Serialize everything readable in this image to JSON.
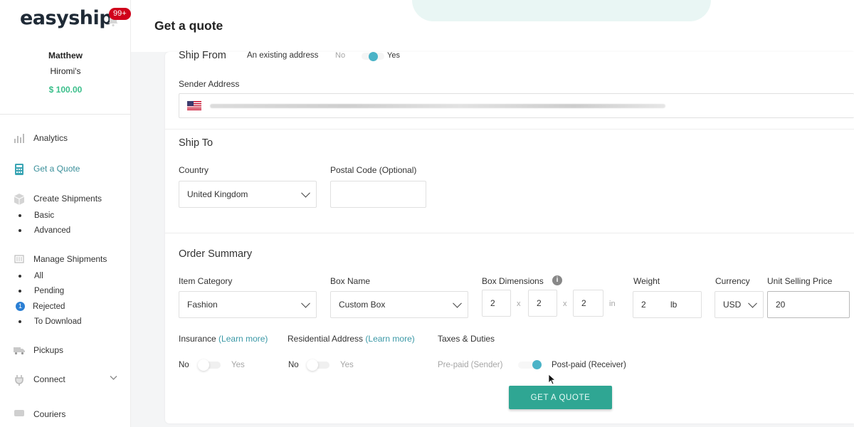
{
  "brand": {
    "logo": "easyship",
    "notification_count": "99+"
  },
  "account": {
    "name_line1": "Matthew",
    "name_line2": "Hiromi's",
    "balance": "$ 100.00"
  },
  "sidebar": {
    "analytics": "Analytics",
    "get_quote": "Get a Quote",
    "create_shipments": "Create Shipments",
    "create_sub": [
      "Basic",
      "Advanced"
    ],
    "manage_shipments": "Manage Shipments",
    "manage_sub": [
      "All",
      "Pending",
      "Rejected",
      "To Download"
    ],
    "rejected_count": "1",
    "pickups": "Pickups",
    "connect": "Connect",
    "couriers": "Couriers"
  },
  "header": {
    "title": "Get a quote"
  },
  "ship_from": {
    "heading": "Ship From",
    "existing_label": "An existing address",
    "no": "No",
    "yes": "Yes",
    "sender_label": "Sender Address"
  },
  "ship_to": {
    "heading": "Ship To",
    "country_label": "Country",
    "country_value": "United Kingdom",
    "postal_label": "Postal Code (Optional)",
    "postal_value": ""
  },
  "order": {
    "heading": "Order Summary",
    "item_category_label": "Item Category",
    "item_category_value": "Fashion",
    "box_name_label": "Box Name",
    "box_name_value": "Custom Box",
    "box_dim_label": "Box Dimensions",
    "dim_l": "2",
    "dim_w": "2",
    "dim_h": "2",
    "x": "x",
    "dim_unit": "in",
    "weight_label": "Weight",
    "weight_value": "2",
    "weight_unit": "lb",
    "currency_label": "Currency",
    "currency_value": "USD",
    "price_label": "Unit Selling Price",
    "price_value": "20"
  },
  "options": {
    "insurance_label": "Insurance",
    "insurance_link": "(Learn more)",
    "residential_label": "Residential Address",
    "residential_link": "(Learn more)",
    "taxes_label": "Taxes & Duties",
    "no": "No",
    "yes": "Yes",
    "prepaid": "Pre-paid (Sender)",
    "postpaid": "Post-paid (Receiver)"
  },
  "cta": {
    "label": "GET A QUOTE"
  },
  "colors": {
    "accent": "#2fa693",
    "link": "#3a98a6",
    "badge": "#d0021b",
    "balance": "#3bbf8b"
  }
}
